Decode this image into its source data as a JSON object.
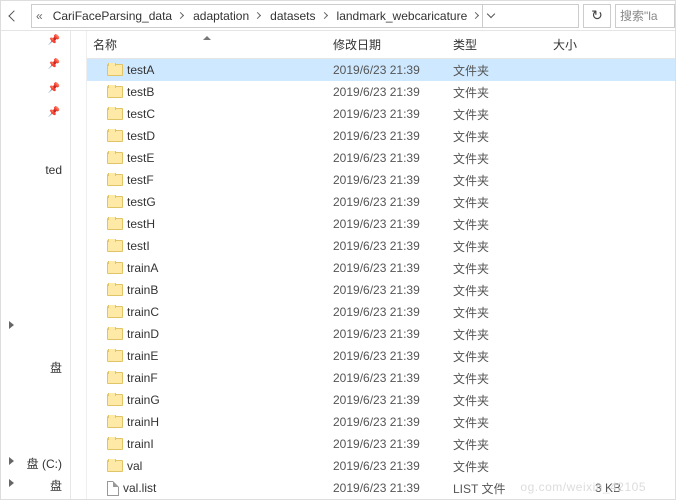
{
  "breadcrumb": {
    "prefix": "«",
    "items": [
      "CariFaceParsing_data",
      "adaptation",
      "datasets",
      "landmark_webcaricature"
    ]
  },
  "search": {
    "placeholder": "搜索\"la"
  },
  "sidebar": {
    "labels": {
      "ted": "ted",
      "pan": "盘",
      "cdrive": "盘 (C:)",
      "ddrive": "盘"
    }
  },
  "columns": {
    "name": "名称",
    "date": "修改日期",
    "type": "类型",
    "size": "大小"
  },
  "type_labels": {
    "folder": "文件夹",
    "list": "LIST 文件"
  },
  "files": [
    {
      "name": "testA",
      "date": "2019/6/23 21:39",
      "type": "folder",
      "size": "",
      "selected": true
    },
    {
      "name": "testB",
      "date": "2019/6/23 21:39",
      "type": "folder",
      "size": ""
    },
    {
      "name": "testC",
      "date": "2019/6/23 21:39",
      "type": "folder",
      "size": ""
    },
    {
      "name": "testD",
      "date": "2019/6/23 21:39",
      "type": "folder",
      "size": ""
    },
    {
      "name": "testE",
      "date": "2019/6/23 21:39",
      "type": "folder",
      "size": ""
    },
    {
      "name": "testF",
      "date": "2019/6/23 21:39",
      "type": "folder",
      "size": ""
    },
    {
      "name": "testG",
      "date": "2019/6/23 21:39",
      "type": "folder",
      "size": ""
    },
    {
      "name": "testH",
      "date": "2019/6/23 21:39",
      "type": "folder",
      "size": ""
    },
    {
      "name": "testI",
      "date": "2019/6/23 21:39",
      "type": "folder",
      "size": ""
    },
    {
      "name": "trainA",
      "date": "2019/6/23 21:39",
      "type": "folder",
      "size": ""
    },
    {
      "name": "trainB",
      "date": "2019/6/23 21:39",
      "type": "folder",
      "size": ""
    },
    {
      "name": "trainC",
      "date": "2019/6/23 21:39",
      "type": "folder",
      "size": ""
    },
    {
      "name": "trainD",
      "date": "2019/6/23 21:39",
      "type": "folder",
      "size": ""
    },
    {
      "name": "trainE",
      "date": "2019/6/23 21:39",
      "type": "folder",
      "size": ""
    },
    {
      "name": "trainF",
      "date": "2019/6/23 21:39",
      "type": "folder",
      "size": ""
    },
    {
      "name": "trainG",
      "date": "2019/6/23 21:39",
      "type": "folder",
      "size": ""
    },
    {
      "name": "trainH",
      "date": "2019/6/23 21:39",
      "type": "folder",
      "size": ""
    },
    {
      "name": "trainI",
      "date": "2019/6/23 21:39",
      "type": "folder",
      "size": ""
    },
    {
      "name": "val",
      "date": "2019/6/23 21:39",
      "type": "folder",
      "size": ""
    },
    {
      "name": "val.list",
      "date": "2019/6/23 21:39",
      "type": "list",
      "size": "3 KB"
    }
  ],
  "watermark": "og.com/weixin_42105"
}
